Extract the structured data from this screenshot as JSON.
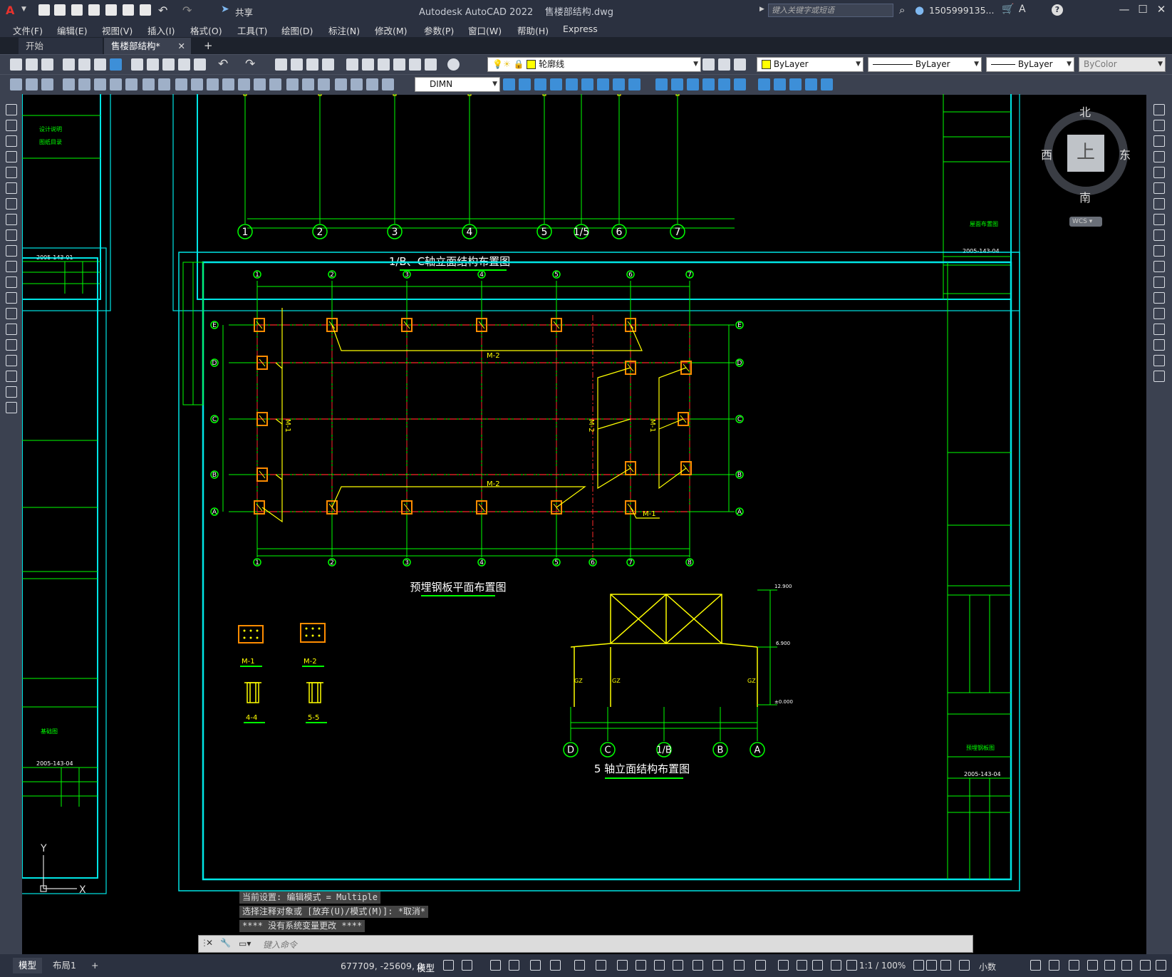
{
  "app": {
    "title": "Autodesk AutoCAD 2022    售楼部结构.dwg",
    "share_label": "共享",
    "search_placeholder": "键入关键字或短语",
    "user": "1505999135...",
    "help": "?"
  },
  "menu": [
    "文件(F)",
    "编辑(E)",
    "视图(V)",
    "插入(I)",
    "格式(O)",
    "工具(T)",
    "绘图(D)",
    "标注(N)",
    "修改(M)",
    "参数(P)",
    "窗口(W)",
    "帮助(H)",
    "Express"
  ],
  "tabs": [
    {
      "label": "开始",
      "active": false
    },
    {
      "label": "售楼部结构*",
      "active": true
    }
  ],
  "toolbar": {
    "layer_combo": "轮廓线",
    "color_combo": "ByLayer",
    "linetype_combo": "ByLayer",
    "lineweight_combo": "ByLayer",
    "plotstyle_combo": "ByColor",
    "dimstyle_combo": "DIMN"
  },
  "viewcube": {
    "north": "北",
    "south": "南",
    "east": "东",
    "west": "西",
    "top": "上",
    "wcs": "WCS"
  },
  "ucs": {
    "x": "X",
    "y": "Y"
  },
  "drawing": {
    "title_top": "1/B、C轴立面结构布置图",
    "title_plan": "预埋钢板平面布置图",
    "title_elev": "5 轴立面结构布置图",
    "m1": "M-1",
    "m2": "M-2",
    "sec44": "4-4",
    "sec55": "5-5",
    "drawing_no": "2005-143-04",
    "drawing_no_left1": "2005-143-01",
    "drawing_no_left2": "2005-143-04",
    "sheet_title": "预埋钢板图",
    "left_title1": "设计说明",
    "left_title1b": "图纸目录",
    "left_title2": "基础图",
    "right_top_title": "屋面布置图",
    "top_axes": [
      "1",
      "2",
      "3",
      "4",
      "5",
      "1/5",
      "6",
      "7"
    ],
    "plan_axes_top": [
      "1",
      "2",
      "3",
      "4",
      "5",
      "6",
      "7"
    ],
    "plan_axes_bottom": [
      "1",
      "2",
      "3",
      "4",
      "5",
      "6",
      "7",
      "8"
    ],
    "plan_rows": [
      "E",
      "D",
      "C",
      "B",
      "A"
    ],
    "elev_axes": [
      "D",
      "C",
      "1/B",
      "B",
      "A"
    ],
    "gz": "GZ",
    "level_top": "12.900",
    "level_mid": "6.900",
    "level_base": "±0.000"
  },
  "command": {
    "history": [
      "当前设置: 编辑模式 = Multiple",
      "选择注释对象或 [放弃(U)/模式(M)]: *取消*",
      "**** 没有系统变量更改 ****"
    ],
    "placeholder": "键入命令"
  },
  "status": {
    "layout_tabs": [
      "模型",
      "布局1"
    ],
    "coords": "677709, -25609, 0",
    "space": "模型",
    "scale": "1:1 / 100%",
    "units": "小数"
  },
  "colors": {
    "frame": "#00e5e5",
    "grid": "#00ff00",
    "axis_line": "#ff2a2a",
    "member": "#ffff00",
    "plate": "#ff8c00"
  }
}
